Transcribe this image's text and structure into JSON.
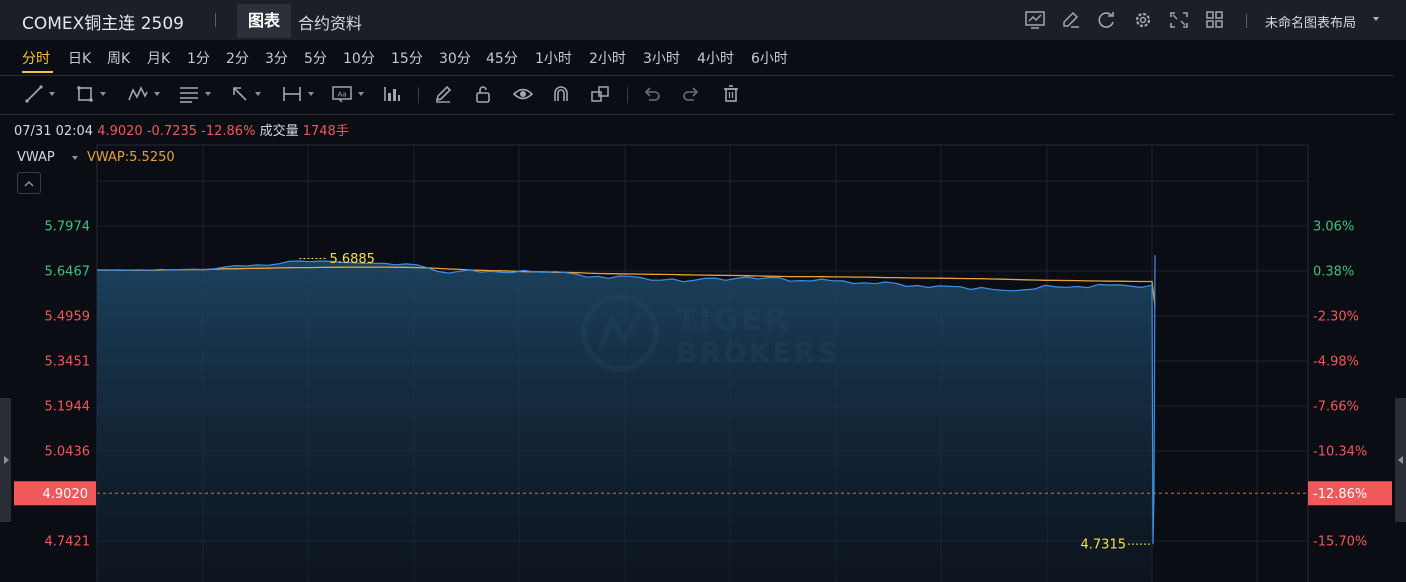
{
  "header": {
    "symbol_title": "COMEX铜主连 2509",
    "tabs": [
      {
        "label": "图表",
        "active": true
      },
      {
        "label": "合约资料",
        "active": false
      }
    ],
    "layout_name": "未命名图表布局",
    "icons": [
      "indicator-icon",
      "draw-icon",
      "refresh-icon",
      "settings-icon",
      "fullscreen-icon",
      "grid-layout-icon"
    ]
  },
  "periods": [
    {
      "label": "分时",
      "active": true
    },
    {
      "label": "日K"
    },
    {
      "label": "周K"
    },
    {
      "label": "月K"
    },
    {
      "label": "1分"
    },
    {
      "label": "2分"
    },
    {
      "label": "3分"
    },
    {
      "label": "5分"
    },
    {
      "label": "10分"
    },
    {
      "label": "15分"
    },
    {
      "label": "30分"
    },
    {
      "label": "45分"
    },
    {
      "label": "1小时"
    },
    {
      "label": "2小时"
    },
    {
      "label": "3小时"
    },
    {
      "label": "4小时"
    },
    {
      "label": "6小时"
    }
  ],
  "info": {
    "time": "07/31 02:04",
    "price": "4.9020",
    "change": "-0.7235",
    "change_pct": "-12.86%",
    "volume_label": "成交量",
    "volume": "1748手"
  },
  "indicator": {
    "name": "VWAP",
    "value_text": "VWAP:5.5250"
  },
  "colors": {
    "background": "#0b0d14",
    "price_line": "#3f8ee8",
    "vwap_line": "#e8a13a",
    "up": "#3fc07a",
    "down": "#f0585a",
    "label_highlight": "#f5e13a",
    "accent": "#f5c242"
  },
  "chart_data": {
    "type": "area",
    "y_axis_left": [
      "5.7974",
      "5.6467",
      "5.4959",
      "5.3451",
      "5.1944",
      "5.0436",
      "4.7421"
    ],
    "y_axis_right": [
      "3.06%",
      "0.38%",
      "-2.30%",
      "-4.98%",
      "-7.66%",
      "-10.34%",
      "-15.70%"
    ],
    "current_price_label": "4.9020",
    "current_pct_label": "-12.86%",
    "high_marker": "5.6885",
    "low_marker": "4.7315",
    "ylim": [
      4.64,
      5.91
    ],
    "reference_price": 5.6255,
    "n_points": 100,
    "series": [
      {
        "name": "price",
        "values": [
          5.65,
          5.6504,
          5.6488,
          5.6498,
          5.6502,
          5.6491,
          5.6519,
          5.6496,
          5.6516,
          5.6528,
          5.6517,
          5.6541,
          5.66,
          5.6648,
          5.6633,
          5.6672,
          5.6657,
          5.6704,
          5.6787,
          5.6801,
          5.6779,
          5.6801,
          5.6788,
          5.6754,
          5.6746,
          5.6721,
          5.6727,
          5.672,
          5.6675,
          5.6704,
          5.6673,
          5.6573,
          5.6449,
          5.6397,
          5.6456,
          5.6503,
          5.6427,
          5.6456,
          5.6421,
          5.6408,
          5.6487,
          5.6435,
          5.6424,
          5.6447,
          5.6412,
          5.6355,
          5.626,
          5.6287,
          5.6221,
          5.63,
          5.629,
          5.6249,
          5.6157,
          5.6163,
          5.6202,
          5.6107,
          5.6151,
          5.6217,
          5.6227,
          5.6156,
          5.6218,
          5.6264,
          5.62,
          5.6244,
          5.6249,
          5.6126,
          5.6145,
          5.6131,
          5.6194,
          5.6138,
          5.6135,
          5.6049,
          5.6071,
          5.6041,
          5.6098,
          5.605,
          5.5947,
          5.598,
          5.5915,
          5.5966,
          5.5952,
          5.594,
          5.5848,
          5.5914,
          5.5852,
          5.5819,
          5.5804,
          5.5832,
          5.5864,
          5.5988,
          5.5935,
          5.592,
          5.5947,
          5.591,
          5.6015,
          5.5997,
          5.6,
          5.5962,
          5.5917,
          5.599
        ]
      },
      {
        "name": "VWAP",
        "values": [
          5.65,
          5.6495,
          5.65,
          5.6493,
          5.6495,
          5.6491,
          5.6501,
          5.6503,
          5.651,
          5.6515,
          5.6515,
          5.6527,
          5.6541,
          5.6541,
          5.655,
          5.6556,
          5.6559,
          5.657,
          5.6577,
          5.6579,
          5.6581,
          5.6587,
          5.6592,
          5.6594,
          5.6596,
          5.6593,
          5.6596,
          5.6596,
          5.6592,
          5.6589,
          5.658,
          5.6569,
          5.6553,
          5.6534,
          5.6519,
          5.6501,
          5.6491,
          5.648,
          5.6473,
          5.646,
          5.6448,
          5.6441,
          5.6437,
          5.6423,
          5.6421,
          5.6409,
          5.6395,
          5.6384,
          5.6376,
          5.6373,
          5.6367,
          5.6362,
          5.6357,
          5.6351,
          5.6348,
          5.634,
          5.6332,
          5.633,
          5.6323,
          5.6318,
          5.6316,
          5.6309,
          5.63,
          5.6293,
          5.6287,
          5.628,
          5.628,
          5.6278,
          5.6275,
          5.6269,
          5.627,
          5.6262,
          5.6263,
          5.6255,
          5.6246,
          5.6244,
          5.6236,
          5.6232,
          5.623,
          5.6225,
          5.6221,
          5.6216,
          5.6211,
          5.6209,
          5.6199,
          5.6193,
          5.6182,
          5.6173,
          5.6164,
          5.6155,
          5.615,
          5.6148,
          5.6145,
          5.6134,
          5.6132,
          5.6126,
          5.6124,
          5.6117,
          5.6115,
          5.6113
        ]
      }
    ],
    "final_drop_to": 4.7315,
    "last_price": 4.902
  }
}
